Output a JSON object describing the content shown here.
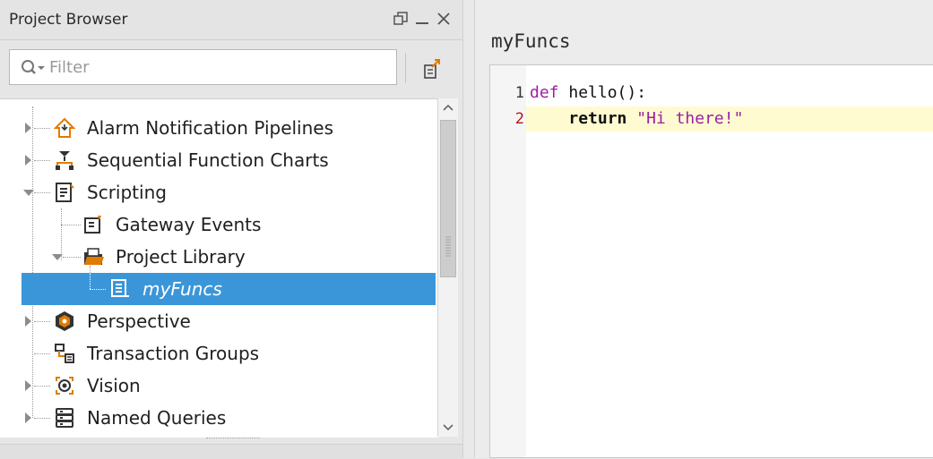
{
  "project_browser": {
    "title": "Project Browser",
    "filter_placeholder": "Filter",
    "tree": [
      {
        "label": "Alarm Notification Pipelines",
        "icon": "alarm-pipeline-icon",
        "expanded": false
      },
      {
        "label": "Sequential Function Charts",
        "icon": "sfc-icon",
        "expanded": false
      },
      {
        "label": "Scripting",
        "icon": "scripting-icon",
        "expanded": true
      },
      {
        "label": "Gateway Events",
        "icon": "gateway-events-icon"
      },
      {
        "label": "Project Library",
        "icon": "folder-icon",
        "expanded": true
      },
      {
        "label": "myFuncs",
        "icon": "script-file-icon",
        "selected": true
      },
      {
        "label": "Perspective",
        "icon": "perspective-icon",
        "expanded": false
      },
      {
        "label": "Transaction Groups",
        "icon": "transaction-groups-icon"
      },
      {
        "label": "Vision",
        "icon": "vision-icon",
        "expanded": false
      },
      {
        "label": "Named Queries",
        "icon": "named-queries-icon",
        "expanded": false
      }
    ]
  },
  "editor": {
    "title": "myFuncs",
    "line_numbers": [
      "1",
      "2"
    ],
    "code": {
      "line1_kw": "def",
      "line1_rest": " hello():",
      "line2_indent": "    ",
      "line2_kw": "return",
      "line2_str": " \"Hi there!\""
    }
  },
  "colors": {
    "selection": "#3b96d9",
    "keyword": "#9b1fa6",
    "current_line": "#fffbd0"
  }
}
